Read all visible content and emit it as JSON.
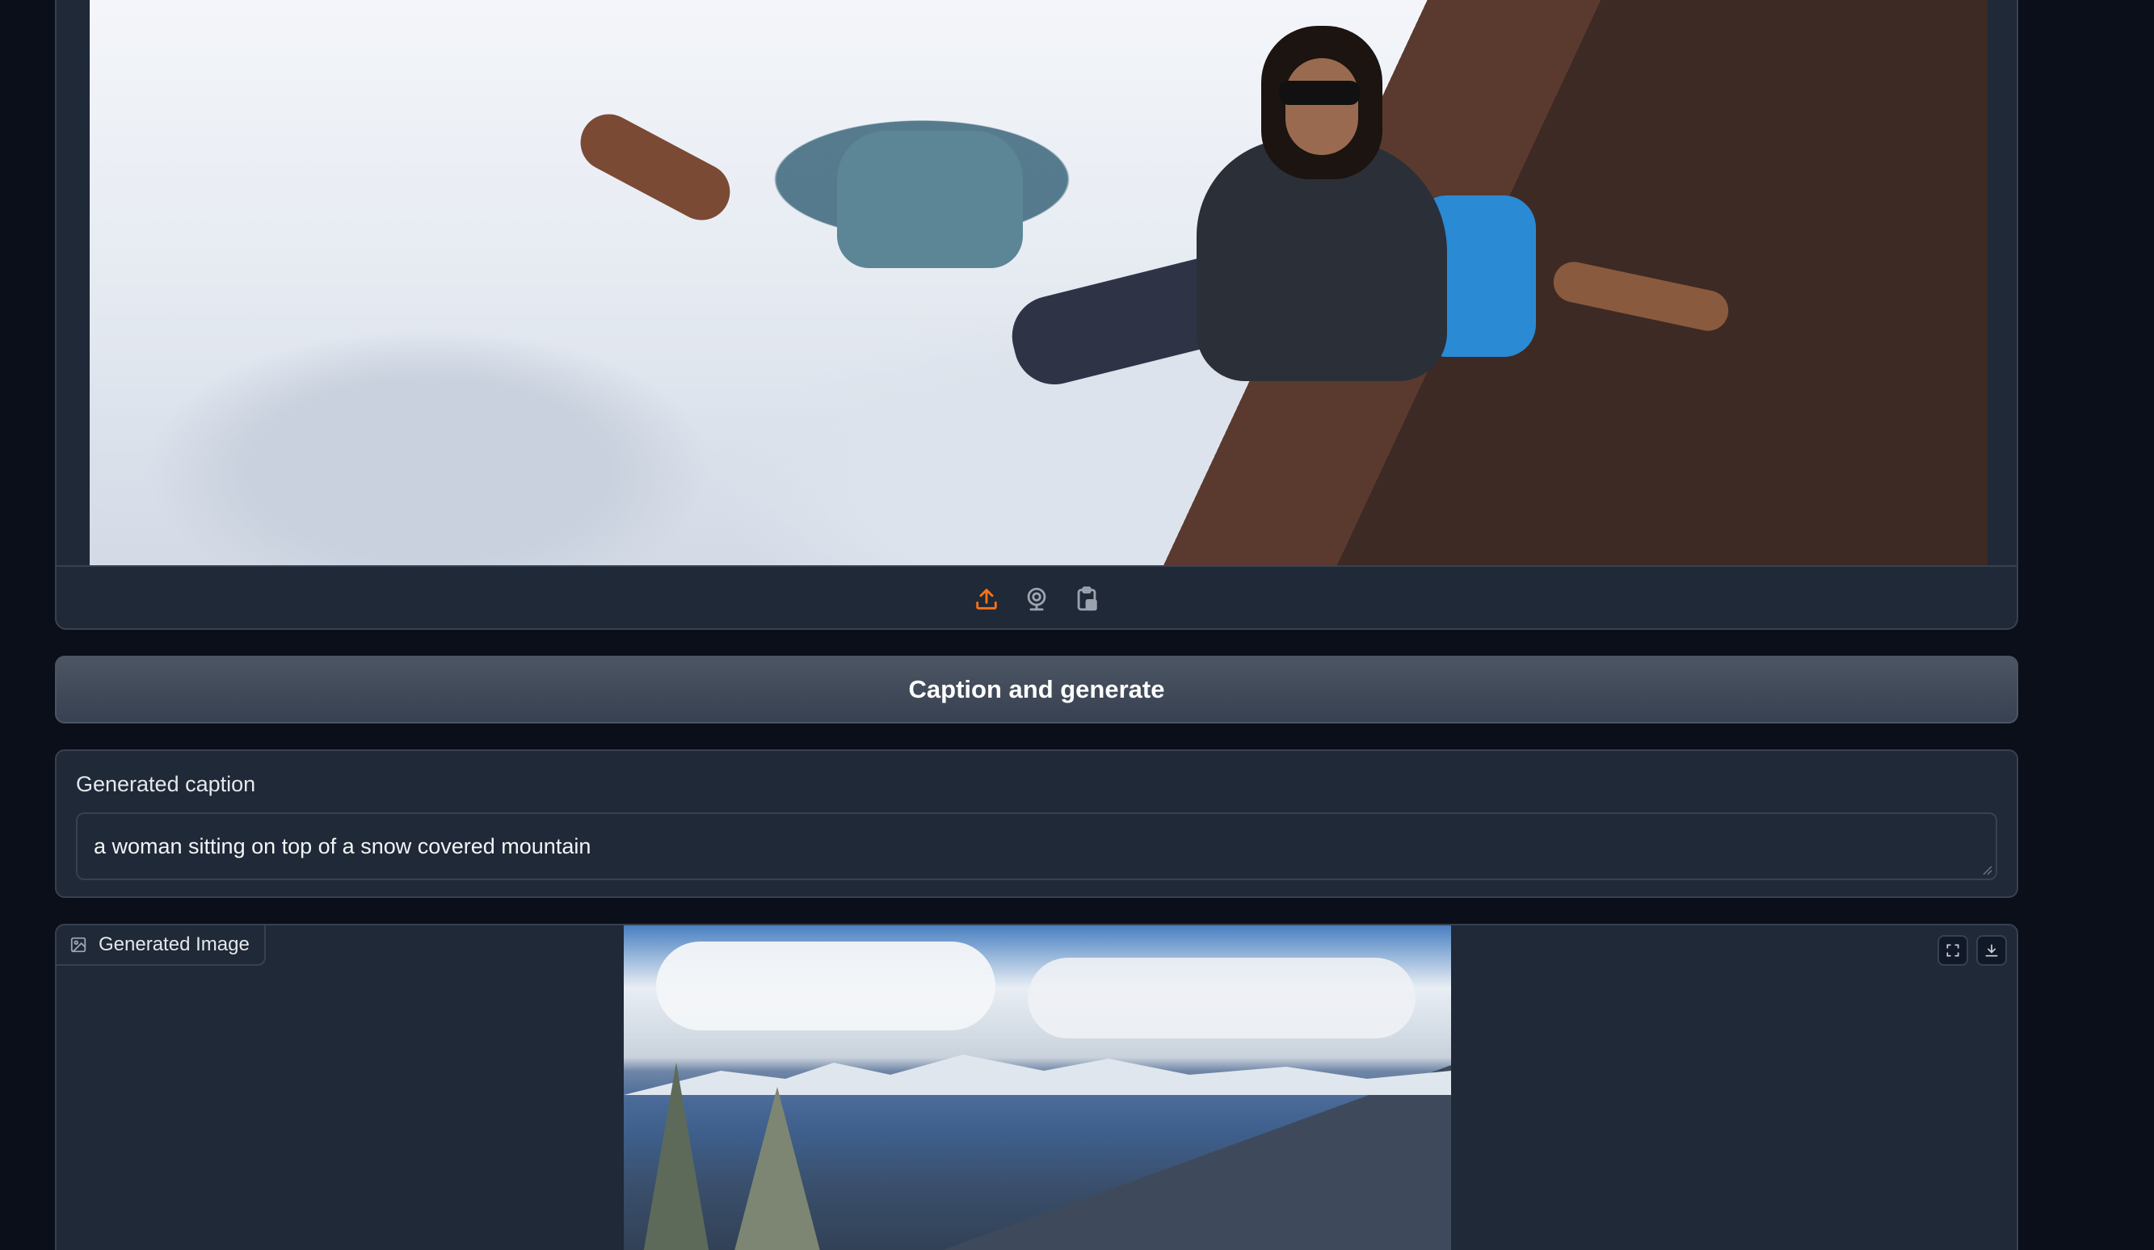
{
  "input_image": {
    "source_buttons": [
      {
        "name": "upload-icon"
      },
      {
        "name": "webcam-icon"
      },
      {
        "name": "clipboard-icon"
      }
    ],
    "accent_color": "#f97316"
  },
  "actions": {
    "caption_button_label": "Caption and generate"
  },
  "caption": {
    "label": "Generated caption",
    "value": "a woman sitting on top of a snow covered mountain"
  },
  "output_image": {
    "label": "Generated Image",
    "controls": [
      {
        "name": "fullscreen-icon"
      },
      {
        "name": "download-icon"
      }
    ]
  },
  "colors": {
    "page_background": "#0b0f19",
    "panel_background": "#1f2937",
    "panel_border": "#374151",
    "button_background": "#4b5563"
  }
}
